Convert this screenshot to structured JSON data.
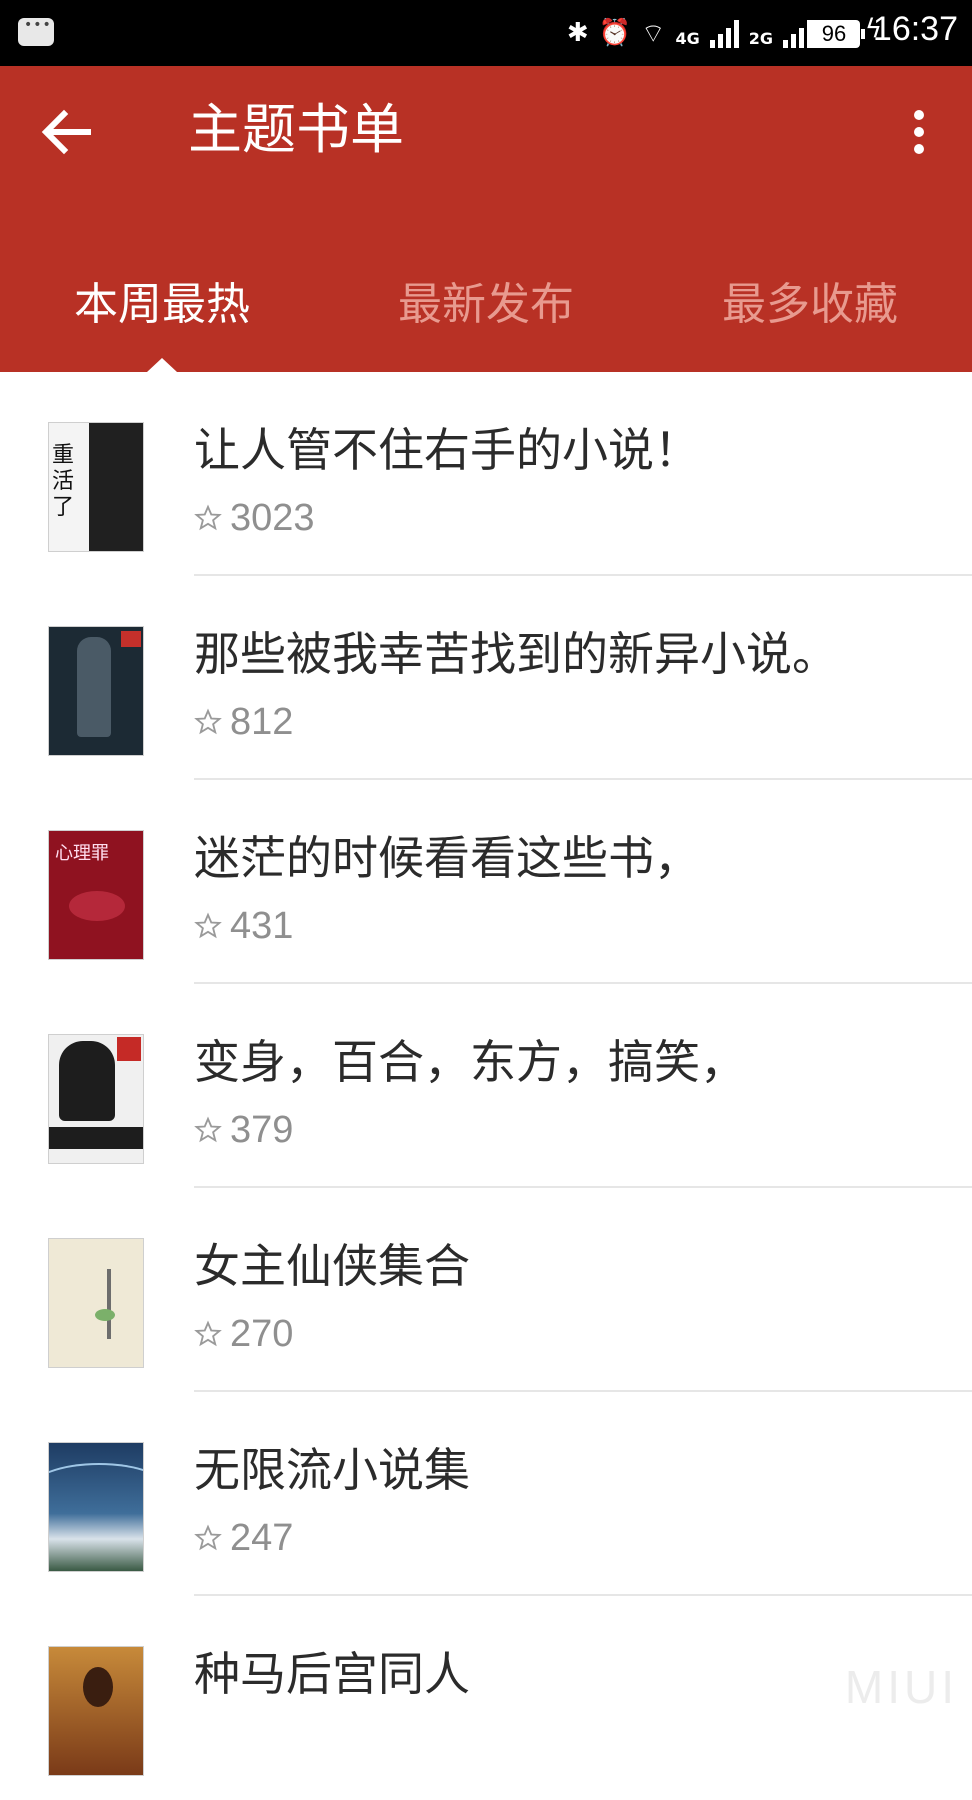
{
  "status_bar": {
    "time": "16:37",
    "battery": "96",
    "network_a": "4G",
    "network_b": "2G"
  },
  "appbar": {
    "title": "主题书单"
  },
  "tabs": [
    {
      "label": "本周最热",
      "active": true
    },
    {
      "label": "最新发布",
      "active": false
    },
    {
      "label": "最多收藏",
      "active": false
    }
  ],
  "booklists": [
    {
      "title": "让人管不住右手的小说！",
      "favorites": "3023",
      "cover_text": "重活了",
      "cover_color": "#f4f4f4"
    },
    {
      "title": "那些被我幸苦找到的新异小说。",
      "favorites": "812",
      "cover_text": "",
      "cover_color": "#1c2a34"
    },
    {
      "title": "迷茫的时候看看这些书，",
      "favorites": "431",
      "cover_text": "心理罪",
      "cover_color": "#8f1220"
    },
    {
      "title": "变身，百合，东方，搞笑，",
      "favorites": "379",
      "cover_text": "",
      "cover_color": "#1d1d1d"
    },
    {
      "title": "女主仙侠集合",
      "favorites": "270",
      "cover_text": "",
      "cover_color": "#efe9d6"
    },
    {
      "title": "无限流小说集",
      "favorites": "247",
      "cover_text": "",
      "cover_color": "#27466b"
    },
    {
      "title": "种马后宫同人",
      "favorites": "",
      "cover_text": "",
      "cover_color": "#7a3a18"
    }
  ],
  "watermark": "MIUI",
  "colors": {
    "accent": "#b83125",
    "inactive_tab": "#e89a8f"
  }
}
